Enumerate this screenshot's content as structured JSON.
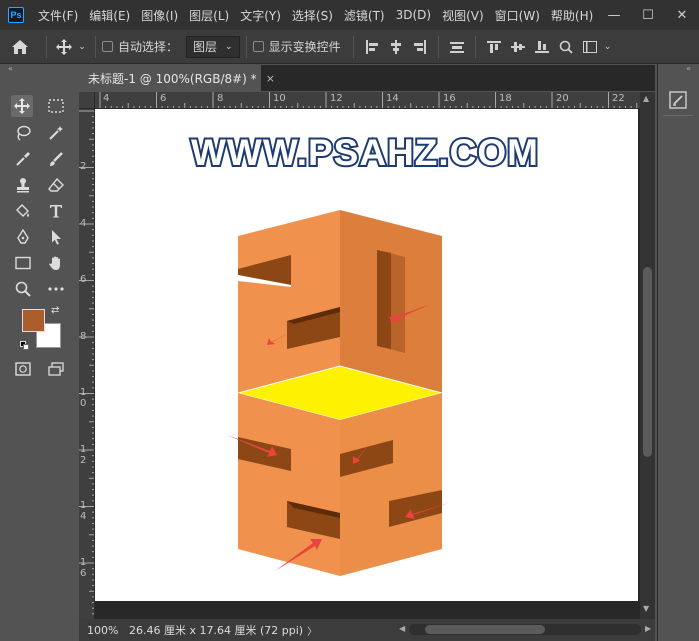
{
  "app": {
    "logo_text": "Ps"
  },
  "menu": [
    "文件(F)",
    "编辑(E)",
    "图像(I)",
    "图层(L)",
    "文字(Y)",
    "选择(S)",
    "滤镜(T)",
    "3D(D)",
    "视图(V)",
    "窗口(W)",
    "帮助(H)"
  ],
  "window_controls": {
    "minimize": "—",
    "maximize": "☐",
    "close": "✕"
  },
  "options": {
    "auto_select_label": "自动选择：",
    "layer_select_value": "图层",
    "show_transform_label": "显示变换控件"
  },
  "document": {
    "tab_title": "未标题-1 @ 100%(RGB/8#) *",
    "tab_close": "×"
  },
  "ruler": {
    "top_labels": [
      "4",
      "6",
      "8",
      "10",
      "12",
      "14",
      "16",
      "18",
      "20",
      "22"
    ],
    "left_labels": [
      "2",
      "4",
      "6",
      "8",
      "1\n0",
      "1\n2",
      "1\n4",
      "1\n6"
    ]
  },
  "canvas": {
    "watermark_text": "WWW.PSAHZ.COM",
    "colors": {
      "orange_light": "#f0924e",
      "orange_dark": "#dc7f3c",
      "orange_shadow": "#8c4715",
      "top_yellow": "#fff200",
      "arrow": "#e8453c"
    }
  },
  "colors": {
    "foreground": "#a95e2b",
    "background": "#ffffff"
  },
  "status": {
    "zoom": "100%",
    "doc_info": "26.46 厘米 x 17.64 厘米 (72 ppi)",
    "arrow": "〉"
  }
}
